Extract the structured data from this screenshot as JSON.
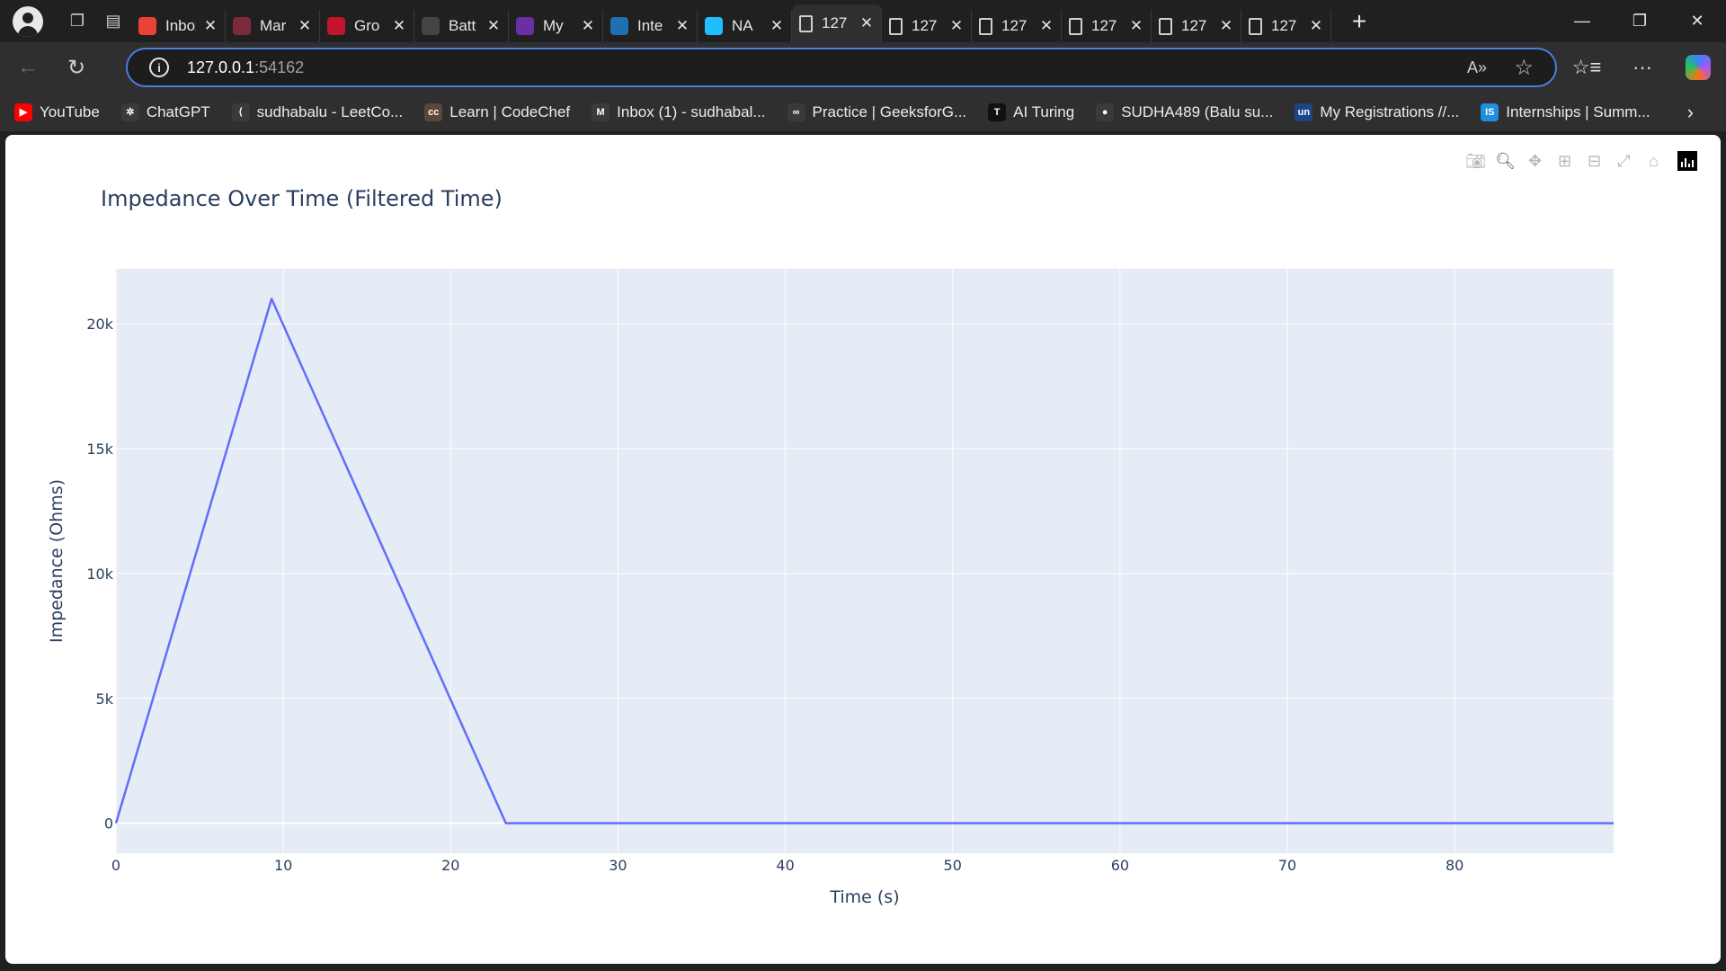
{
  "browser": {
    "tabs": [
      {
        "title": "Inbox",
        "icon": "gmail-icon",
        "color": "#ea4335"
      },
      {
        "title": "Mar",
        "icon": "image-icon",
        "color": "#7a2a3a"
      },
      {
        "title": "Gro",
        "icon": "youtube-icon",
        "color": "#c4122f"
      },
      {
        "title": "Batt",
        "icon": "chatgpt-icon",
        "color": "#444444"
      },
      {
        "title": "My",
        "icon": "unstop-icon",
        "color": "#6b2fa3"
      },
      {
        "title": "Inte",
        "icon": "internshala-icon",
        "color": "#1f6fb2"
      },
      {
        "title": "NA",
        "icon": "kaggle-icon",
        "color": "#20beff"
      },
      {
        "title": "127",
        "icon": "document-icon",
        "color": "transparent",
        "active": true
      },
      {
        "title": "127",
        "icon": "document-icon",
        "color": "transparent"
      },
      {
        "title": "127",
        "icon": "document-icon",
        "color": "transparent"
      },
      {
        "title": "127",
        "icon": "document-icon",
        "color": "transparent"
      },
      {
        "title": "127",
        "icon": "document-icon",
        "color": "transparent"
      },
      {
        "title": "127",
        "icon": "document-icon",
        "color": "transparent"
      }
    ],
    "address": {
      "host": "127.0.0.1",
      "port": ":54162"
    },
    "bookmarks": [
      {
        "label": "YouTube",
        "icon": "youtube-icon",
        "color": "#ff0000",
        "glyph": "▶"
      },
      {
        "label": "ChatGPT",
        "icon": "chatgpt-icon",
        "color": "#3a3a3a",
        "glyph": "✲"
      },
      {
        "label": "sudhabalu - LeetCo...",
        "icon": "leetcode-icon",
        "color": "#3a3a3a",
        "glyph": "⟨"
      },
      {
        "label": "Learn | CodeChef",
        "icon": "codechef-icon",
        "color": "#5b4638",
        "glyph": "cc"
      },
      {
        "label": "Inbox (1) - sudhabal...",
        "icon": "gmail-icon",
        "color": "#3a3a3a",
        "glyph": "M"
      },
      {
        "label": "Practice | GeeksforG...",
        "icon": "geeksforgeeks-icon",
        "color": "#3a3a3a",
        "glyph": "∞"
      },
      {
        "label": "AI Turing",
        "icon": "turing-icon",
        "color": "#111111",
        "glyph": "T"
      },
      {
        "label": "SUDHA489 (Balu su...",
        "icon": "github-icon",
        "color": "#3a3a3a",
        "glyph": "●"
      },
      {
        "label": "My Registrations //...",
        "icon": "unstop-icon",
        "color": "#1c4587",
        "glyph": "un"
      },
      {
        "label": "Internships | Summ...",
        "icon": "internshala-icon",
        "color": "#1f8fe0",
        "glyph": "IS"
      }
    ]
  },
  "chart_data": {
    "type": "line",
    "title": "Impedance Over Time (Filtered Time)",
    "xlabel": "Time (s)",
    "ylabel": "Impedance (Ohms)",
    "xlim": [
      0,
      89.5
    ],
    "ylim": [
      -1200,
      22200
    ],
    "x_ticks": [
      0,
      10,
      20,
      30,
      40,
      50,
      60,
      70,
      80
    ],
    "x_tick_labels": [
      "0",
      "10",
      "20",
      "30",
      "40",
      "50",
      "60",
      "70",
      "80"
    ],
    "y_ticks": [
      0,
      5000,
      10000,
      15000,
      20000
    ],
    "y_tick_labels": [
      "0",
      "5k",
      "10k",
      "15k",
      "20k"
    ],
    "grid": true,
    "series": [
      {
        "color": "#636efa",
        "x": [
          0,
          9.3,
          23.3,
          89.5
        ],
        "y": [
          0,
          21000,
          0,
          0
        ]
      }
    ]
  }
}
